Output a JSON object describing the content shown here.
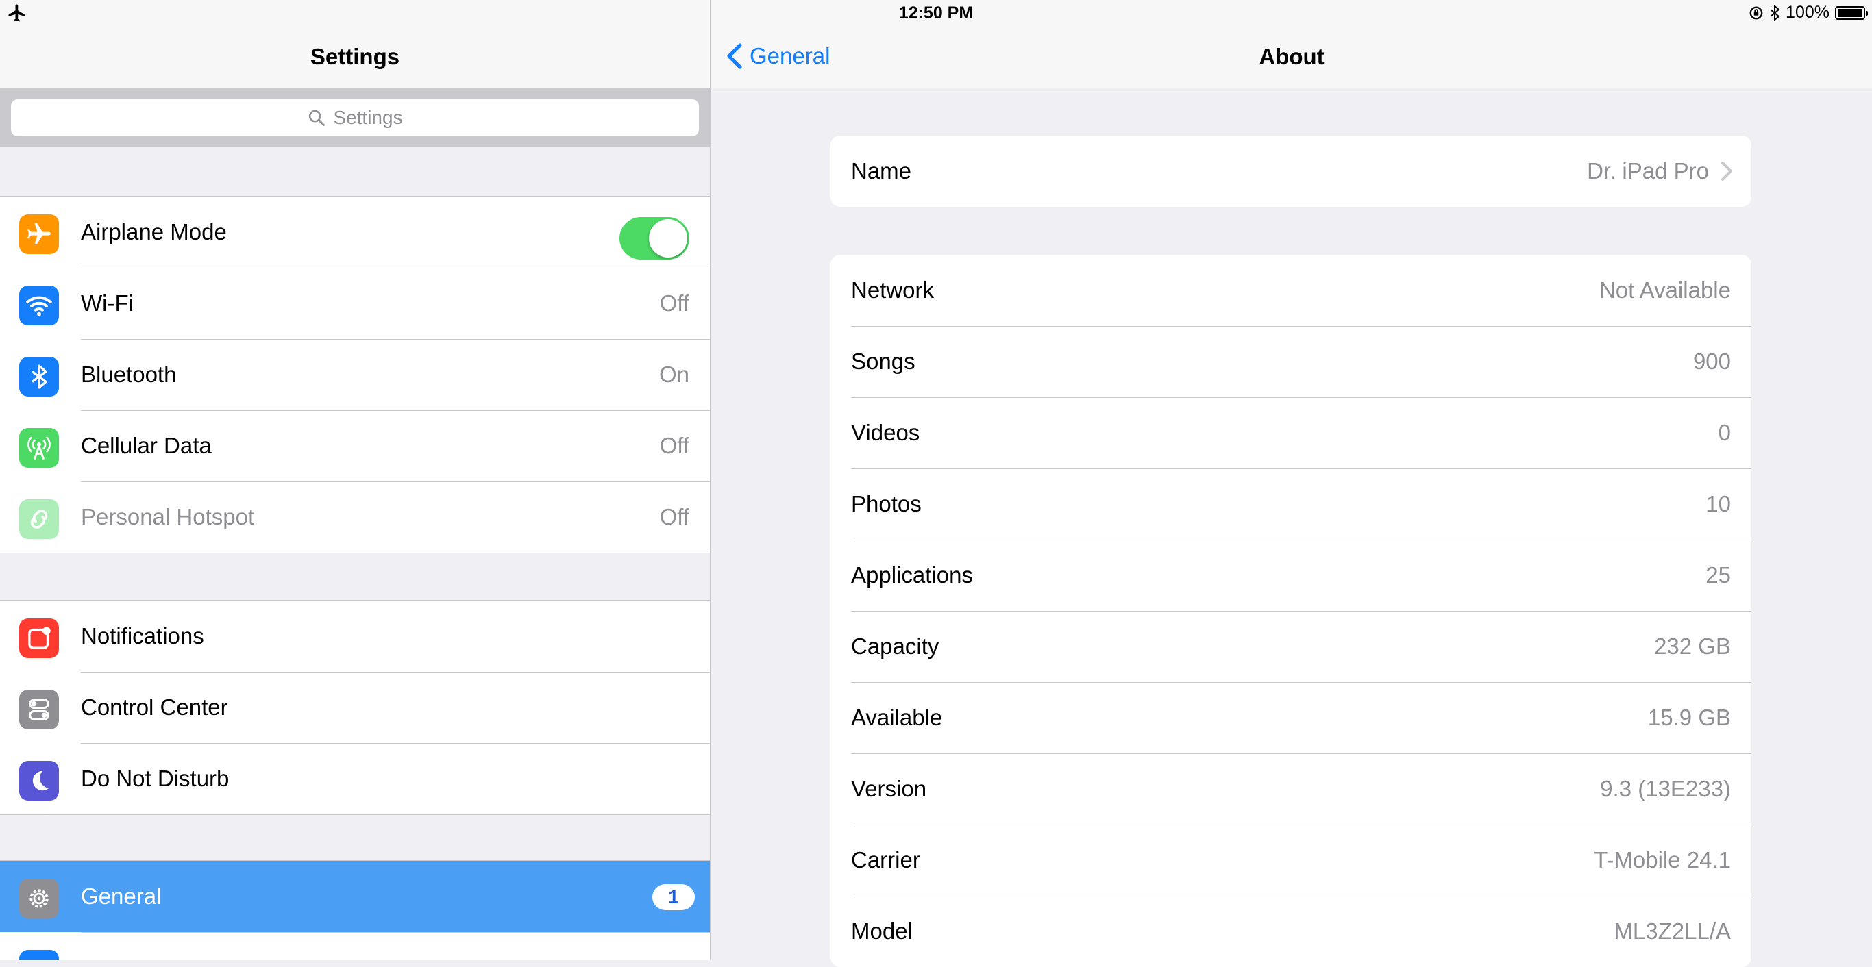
{
  "status_bar": {
    "time": "12:50 PM",
    "battery": "100%"
  },
  "master": {
    "title": "Settings",
    "search_placeholder": "Settings",
    "group1": [
      {
        "label": "Airplane Mode",
        "toggle_on": true,
        "icon": "airplane-icon",
        "color": "#ff9500"
      },
      {
        "label": "Wi-Fi",
        "value": "Off",
        "icon": "wifi-icon",
        "color": "#147efb"
      },
      {
        "label": "Bluetooth",
        "value": "On",
        "icon": "bluetooth-icon",
        "color": "#147efb"
      },
      {
        "label": "Cellular Data",
        "value": "Off",
        "icon": "cellular-icon",
        "color": "#4cd964"
      },
      {
        "label": "Personal Hotspot",
        "value": "Off",
        "icon": "hotspot-icon",
        "color": "#4cd964"
      }
    ],
    "group2": [
      {
        "label": "Notifications",
        "icon": "notifications-icon",
        "color": "#ff3b30"
      },
      {
        "label": "Control Center",
        "icon": "control-center-icon",
        "color": "#8e8e93"
      },
      {
        "label": "Do Not Disturb",
        "icon": "moon-icon",
        "color": "#5856d6"
      }
    ],
    "group3": [
      {
        "label": "General",
        "badge": "1",
        "icon": "gear-icon",
        "color": "#8e8e93",
        "selected": true
      }
    ]
  },
  "detail": {
    "back_label": "General",
    "title": "About",
    "name_row": {
      "key": "Name",
      "value": "Dr. iPad Pro"
    },
    "rows": [
      {
        "key": "Network",
        "value": "Not Available"
      },
      {
        "key": "Songs",
        "value": "900"
      },
      {
        "key": "Videos",
        "value": "0"
      },
      {
        "key": "Photos",
        "value": "10"
      },
      {
        "key": "Applications",
        "value": "25"
      },
      {
        "key": "Capacity",
        "value": "232 GB"
      },
      {
        "key": "Available",
        "value": "15.9 GB"
      },
      {
        "key": "Version",
        "value": "9.3 (13E233)"
      },
      {
        "key": "Carrier",
        "value": "T-Mobile 24.1"
      },
      {
        "key": "Model",
        "value": "ML3Z2LL/A"
      }
    ]
  }
}
